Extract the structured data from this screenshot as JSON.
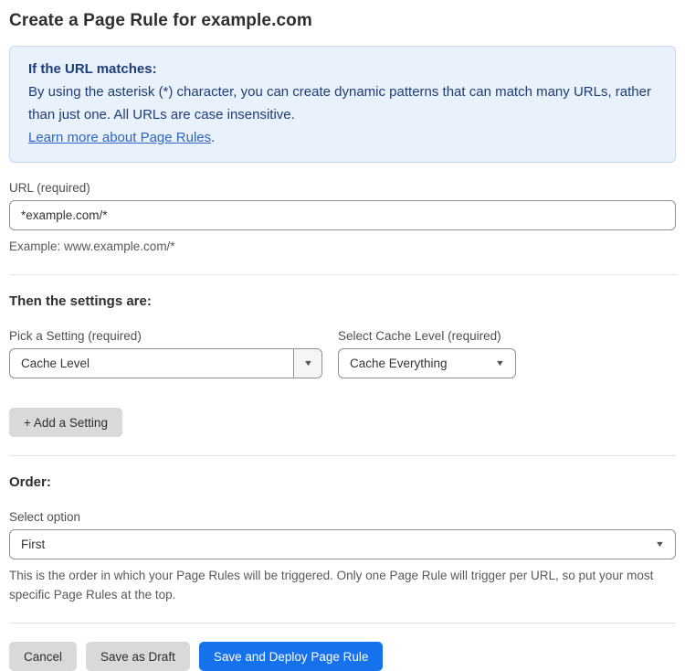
{
  "page": {
    "title": "Create a Page Rule for example.com"
  },
  "info_box": {
    "heading": "If the URL matches:",
    "body": "By using the asterisk (*) character, you can create dynamic patterns that can match many URLs, rather than just one. All URLs are case insensitive.",
    "link_label": "Learn more about Page Rules",
    "link_suffix": "."
  },
  "url_field": {
    "label": "URL (required)",
    "value": "*example.com/*",
    "helper": "Example: www.example.com/*"
  },
  "settings_section": {
    "heading": "Then the settings are:",
    "setting_picker": {
      "label": "Pick a Setting (required)",
      "value": "Cache Level"
    },
    "cache_level_picker": {
      "label": "Select Cache Level (required)",
      "value": "Cache Everything"
    },
    "add_setting_label": "+ Add a Setting"
  },
  "order_section": {
    "heading": "Order:",
    "label": "Select option",
    "value": "First",
    "helper": "This is the order in which your Page Rules will be triggered. Only one Page Rule will trigger per URL, so put your most specific Page Rules at the top."
  },
  "actions": {
    "cancel": "Cancel",
    "save_draft": "Save as Draft",
    "save_deploy": "Save and Deploy Page Rule"
  },
  "icons": {
    "dropdown_arrow": "▼"
  },
  "colors": {
    "info_bg": "#e8f1fc",
    "info_border": "#c3daf3",
    "info_text": "#1e3c78",
    "link_blue": "#2d64c8",
    "primary_button_blue": "#1672ec",
    "gray_button": "#d9d9d9",
    "border_gray": "#8f8f8f"
  }
}
